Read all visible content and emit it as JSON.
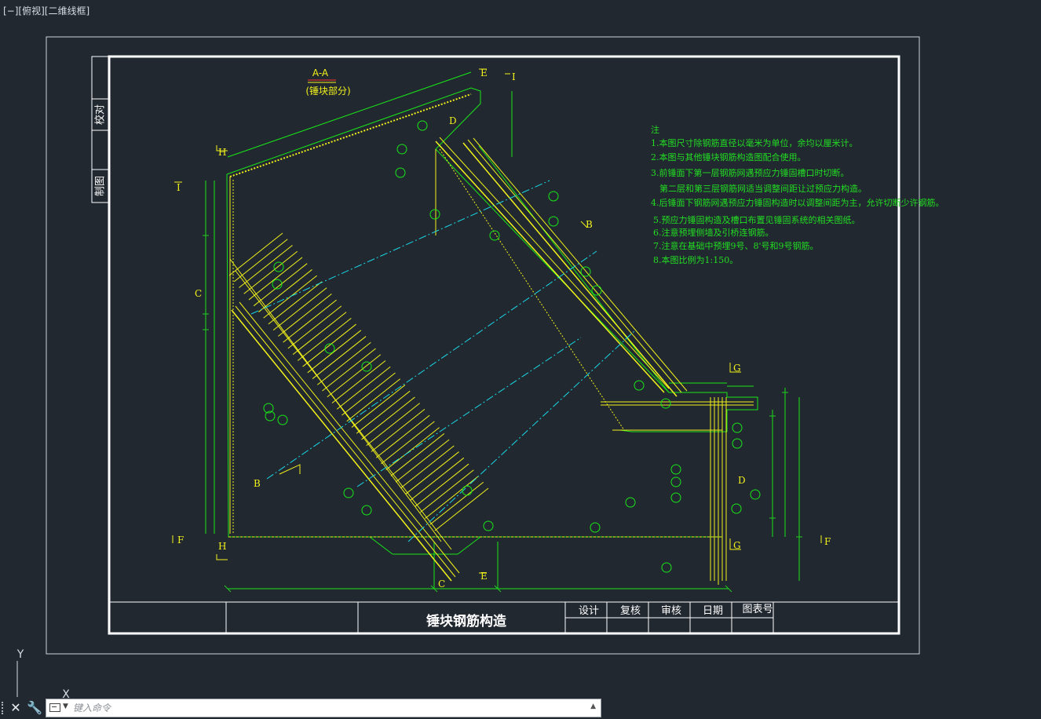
{
  "viewport": {
    "label": "[−][俯视][二维线框]"
  },
  "drawing": {
    "section_title": "A-A",
    "section_subtitle": "(锤块部分)",
    "side_labels": [
      "校对",
      "制图"
    ],
    "section_letters": [
      "A",
      "B",
      "C",
      "D",
      "E",
      "F",
      "G",
      "H",
      "I"
    ],
    "notes_title": "注",
    "notes": [
      "1.本图尺寸除钢筋直径以毫米为单位，余均以厘米计。",
      "2.本图与其他锤块钢筋构造图配合使用。",
      "3.前锤面下第一层钢筋网遇预应力锤固槽口时切断。",
      "第二层和第三层钢筋网适当调整间距让过预应力构造。",
      "4.后锤面下钢筋网遇预应力锤固构造时以调整间距为主，允许切断少许钢筋。",
      "5.预应力锤固构造及槽口布置见锤固系统的相关图纸。",
      "6.注意预埋侧墙及引桥连钢筋。",
      "7.注意在基础中预埋9号、8'号和9号钢筋。",
      "8.本图比例为1:150。"
    ],
    "title_block": {
      "drawing_name": "锤块钢筋构造",
      "design": "设计",
      "review": "复核",
      "approve": "审核",
      "date": "日期",
      "sheet_no": "图表号"
    }
  },
  "ucs": {
    "y_label": "Y",
    "x_label": "X"
  },
  "command": {
    "placeholder": "键入命令"
  },
  "colors": {
    "background": "#212830",
    "frame": "#ffffff",
    "drawing_green": "#19e619",
    "rebar_yellow": "#f2f21a",
    "axis_cyan": "#19d9e6",
    "dim_green": "#22cc22"
  }
}
